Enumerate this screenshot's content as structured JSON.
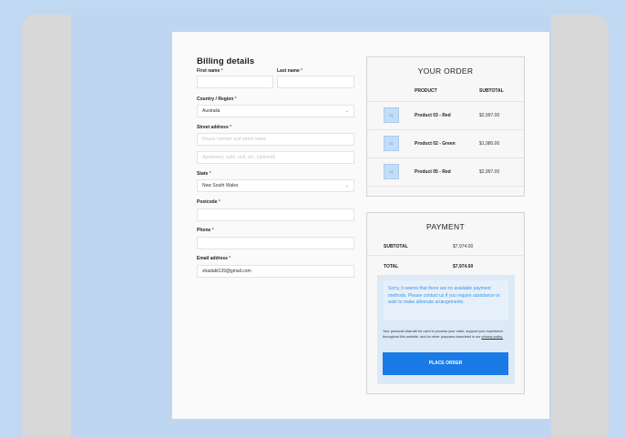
{
  "billing": {
    "title": "Billing details",
    "first_name_label": "First name",
    "last_name_label": "Last name",
    "required_mark": "*",
    "country_label": "Country / Region",
    "country_value": "Australia",
    "street_label": "Street address",
    "street_placeholder_1": "House number and street name",
    "street_placeholder_2": "Apartment, suite, unit, etc. (optional)",
    "state_label": "State",
    "state_value": "New South Wales",
    "postcode_label": "Postcode",
    "phone_label": "Phone",
    "email_label": "Email address",
    "email_value": "shadabl139@gmail.com"
  },
  "order": {
    "title": "YOUR ORDER",
    "col_product": "PRODUCT",
    "col_subtotal": "SUBTOTAL",
    "items": [
      {
        "thumb": "01",
        "name": "Product 03 - Red",
        "price": "$2,997.00"
      },
      {
        "thumb": "01",
        "name": "Product 02 - Green",
        "price": "$1,980.00"
      },
      {
        "thumb": "01",
        "name": "Product 05 - Red",
        "price": "$2,997.00"
      }
    ]
  },
  "payment": {
    "title": "PAYMENT",
    "subtotal_label": "SUBTOTAL",
    "subtotal_value": "$7,974.00",
    "total_label": "TOTAL",
    "total_value": "$7,974.00",
    "notice": "Sorry, it seems that there are no available payment methods. Please contact us if you require assistance or wish to make alternate arrangements.",
    "privacy_text": "Your personal data will be used to process your order, support your experience throughout this website, and for other purposes described in our",
    "privacy_link": "privacy policy.",
    "place_order": "PLACE ORDER"
  },
  "colors": {
    "page_bg": "#c1d8f2",
    "accent": "#1a7ae6",
    "notice_text": "#3b93e6"
  }
}
